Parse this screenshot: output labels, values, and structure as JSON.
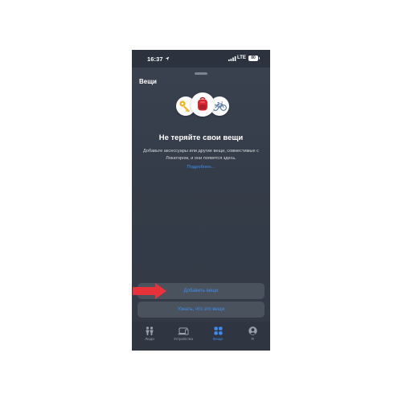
{
  "status_bar": {
    "time": "16:37",
    "network": "LTE",
    "battery": "80",
    "location_icon": "location-arrow-icon",
    "signal_icon": "cellular-signal-icon"
  },
  "sheet": {
    "title": "Вещи",
    "illustration_icons": [
      "key-icon",
      "backpack-icon",
      "bicycle-icon"
    ]
  },
  "empty_state": {
    "title": "Не теряйте свои вещи",
    "description": "Добавьте аксессуары или другие вещи, совместимые с Локатором, и они появятся здесь.",
    "link": "Подробнее..."
  },
  "buttons": {
    "add_items": "Добавить вещи",
    "what_is_this": "Узнать, что это вещи"
  },
  "tabs": [
    {
      "label": "Люди",
      "icon": "people-icon",
      "active": false
    },
    {
      "label": "Устройства",
      "icon": "devices-icon",
      "active": false
    },
    {
      "label": "Вещи",
      "icon": "items-grid-icon",
      "active": true
    },
    {
      "label": "Я",
      "icon": "person-circle-icon",
      "active": false
    }
  ],
  "colors": {
    "accent": "#3d8ef0",
    "background": "#353c49",
    "button": "#4a525e",
    "annotation_arrow": "#e8323a"
  }
}
